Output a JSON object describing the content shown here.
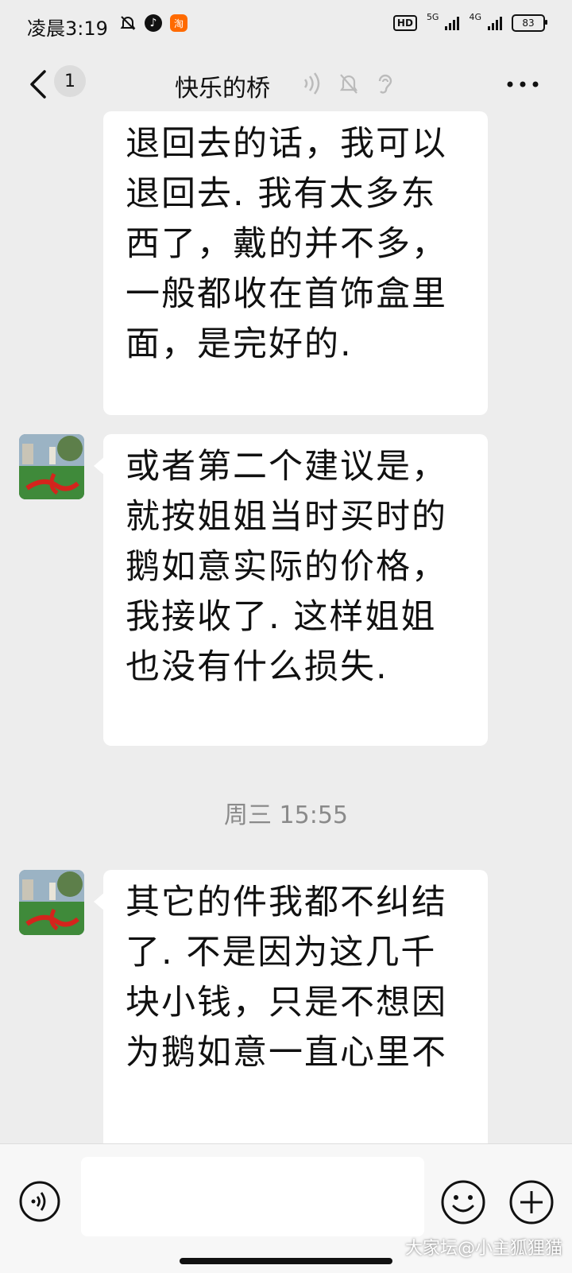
{
  "status_bar": {
    "time": "凌晨3:19",
    "hd": "HD",
    "net_5g": "5G",
    "net_4g": "4G",
    "battery": "83",
    "icons": [
      "mute-bell-icon",
      "tiktok-icon",
      "taobao-icon"
    ]
  },
  "header": {
    "unread_count": "1",
    "title": "快乐的桥",
    "icons": [
      "voice-icon",
      "mute-icon",
      "ear-icon",
      "more-icon"
    ]
  },
  "messages": [
    {
      "text": "退回去的话，我可以退回去. 我有太多东西了，戴的并不多，一般都收在首饰盒里面，是完好的."
    },
    {
      "text": "或者第二个建议是，就按姐姐当时买时的鹅如意实际的价格，我接收了. 这样姐姐也没有什么损失."
    },
    {
      "time": "周三 15:55"
    },
    {
      "text": "其它的件我都不纠结了. 不是因为这几千块小钱，只是不想因为鹅如意一直心里不"
    }
  ],
  "input_bar": {
    "placeholder": "",
    "icons": [
      "voice-input-icon",
      "emoji-icon",
      "plus-icon"
    ]
  },
  "watermark": "大家坛@小主狐狸猫",
  "colors": {
    "background": "#ededed",
    "bubble": "#ffffff",
    "timestamp": "#8a8a8a"
  }
}
